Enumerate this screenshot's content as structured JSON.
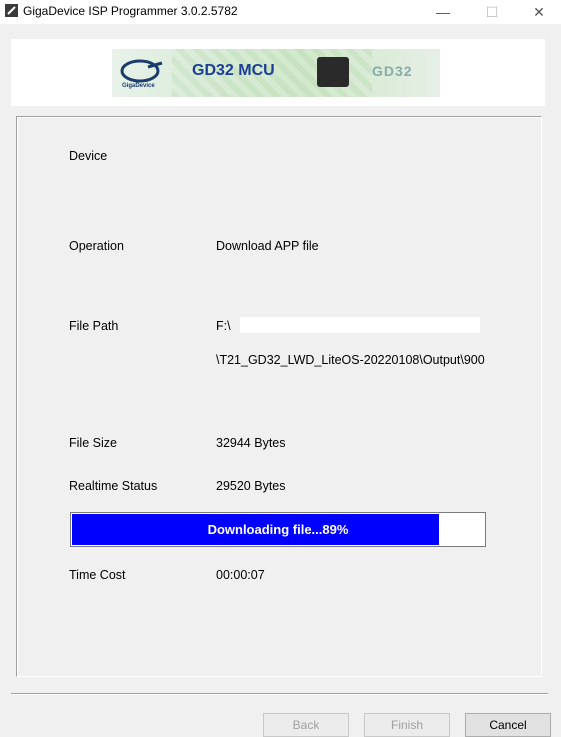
{
  "window": {
    "title": "GigaDevice ISP Programmer 3.0.2.5782",
    "minimize_glyph": "—",
    "maximize_glyph": "☐",
    "close_glyph": "✕"
  },
  "banner": {
    "logo_text": "GigaDevice",
    "product_text": "GD32 MCU",
    "chip_text": "GD32"
  },
  "form": {
    "device_label": "Device",
    "device_value": "",
    "operation_label": "Operation",
    "operation_value": "Download APP file",
    "file_path_label": "File Path",
    "file_path_line1": "F:\\",
    "file_path_line2": "\\T21_GD32_LWD_LiteOS-20220108\\Output\\900",
    "file_size_label": "File Size",
    "file_size_value": "32944 Bytes",
    "realtime_status_label": "Realtime Status",
    "realtime_status_value": "29520 Bytes",
    "time_cost_label": "Time Cost",
    "time_cost_value": "00:00:07"
  },
  "progress": {
    "text": "Downloading file...89%",
    "percent": 89,
    "fill_color": "#0000ff"
  },
  "buttons": {
    "back": "Back",
    "finish": "Finish",
    "cancel": "Cancel"
  }
}
